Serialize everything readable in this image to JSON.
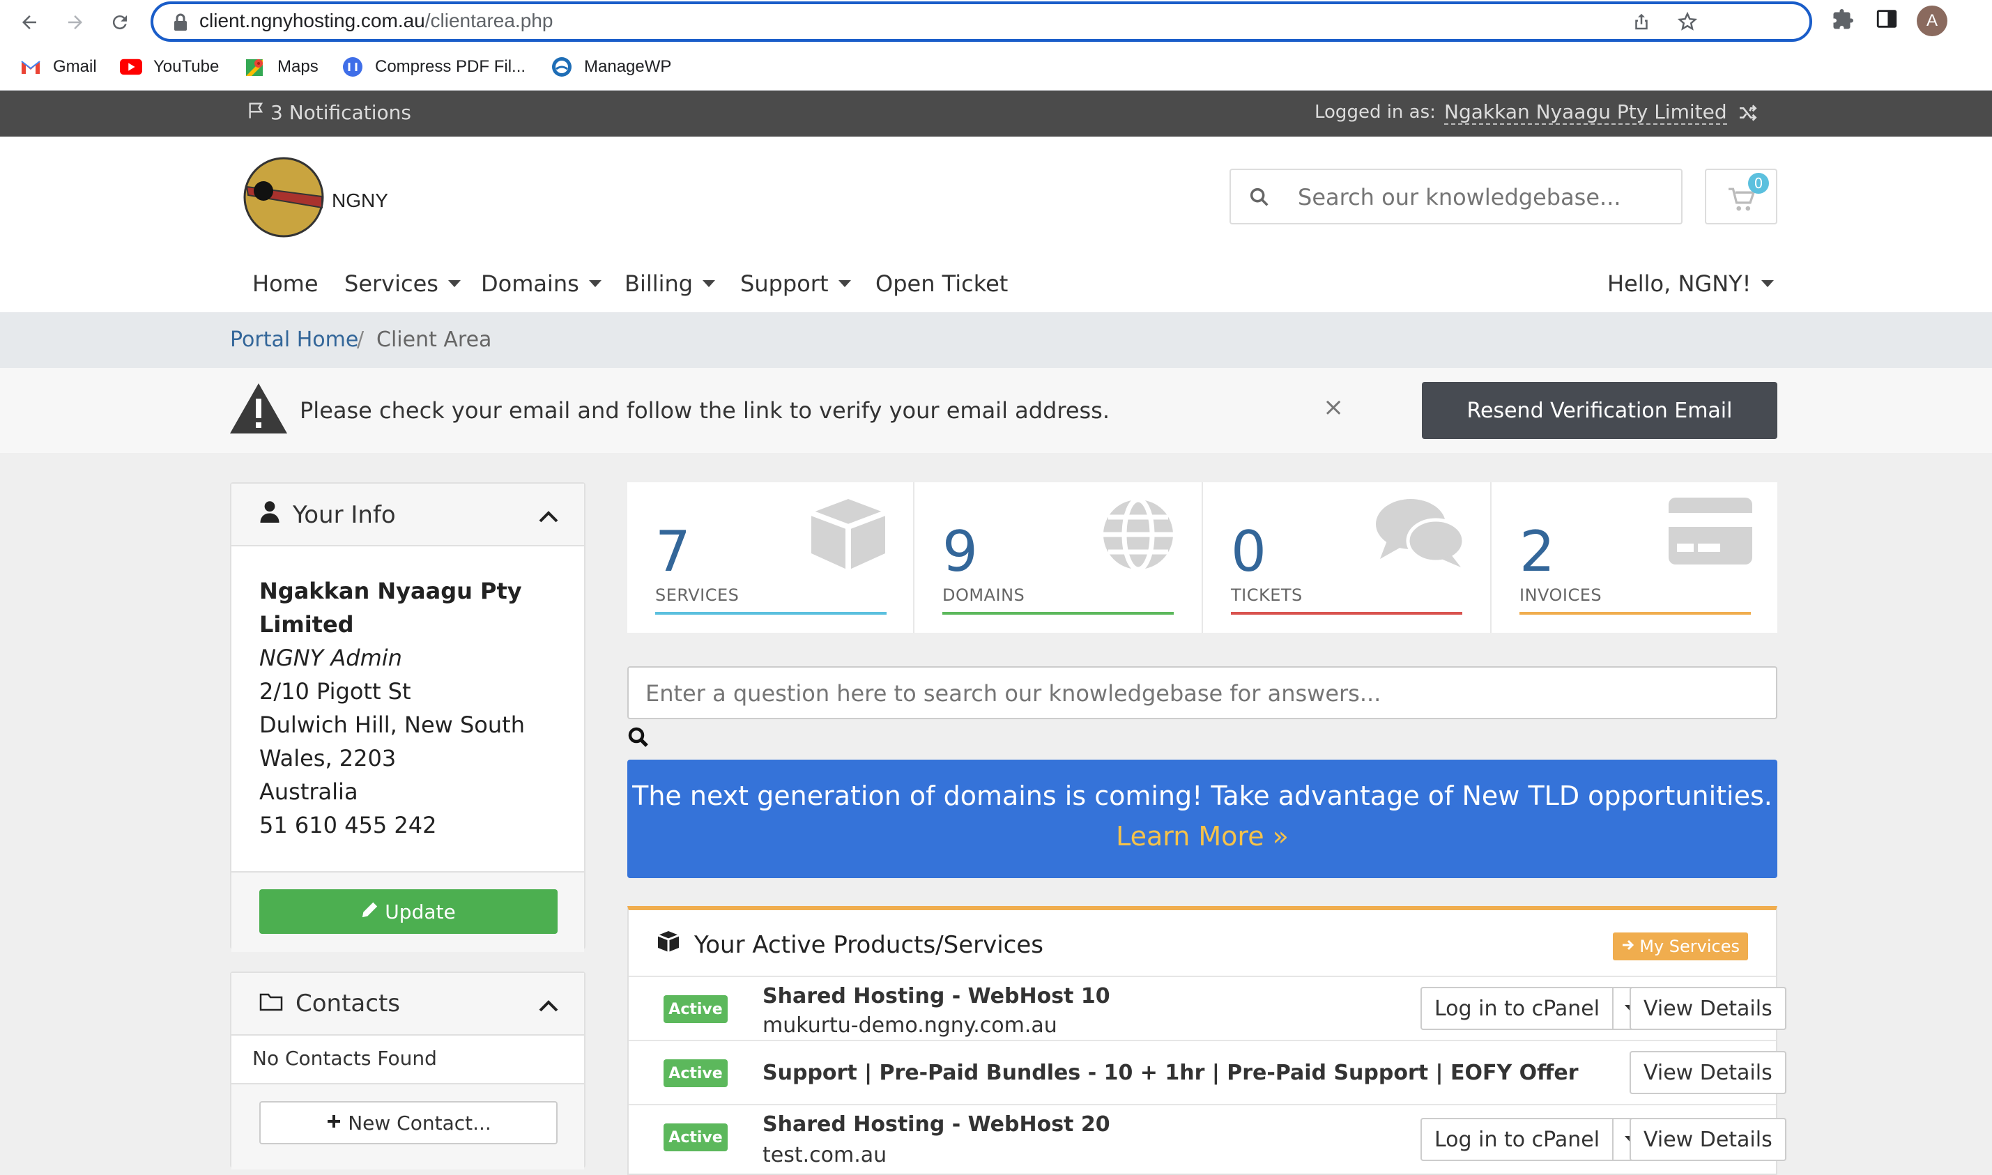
{
  "browser": {
    "url_host": "client.ngnyhosting.com.au",
    "url_path": "/clientarea.php",
    "profile_initial": "A",
    "bookmarks": [
      {
        "label": "Gmail",
        "icon": "gmail-icon"
      },
      {
        "label": "YouTube",
        "icon": "youtube-icon"
      },
      {
        "label": "Maps",
        "icon": "maps-icon"
      },
      {
        "label": "Compress PDF Fil...",
        "icon": "pdf-icon"
      },
      {
        "label": "ManageWP",
        "icon": "managewp-icon"
      }
    ]
  },
  "topbar": {
    "notifications": "3 Notifications",
    "logged_in_label": "Logged in as:",
    "logged_in_name": "Ngakkan Nyaagu Pty Limited"
  },
  "header": {
    "logo_text": "NGNY",
    "search_placeholder": "Search our knowledgebase...",
    "cart_count": "0"
  },
  "nav": {
    "items": [
      {
        "label": "Home",
        "dropdown": false
      },
      {
        "label": "Services",
        "dropdown": true
      },
      {
        "label": "Domains",
        "dropdown": true
      },
      {
        "label": "Billing",
        "dropdown": true
      },
      {
        "label": "Support",
        "dropdown": true
      },
      {
        "label": "Open Ticket",
        "dropdown": false
      }
    ],
    "user_menu": "Hello, NGNY!"
  },
  "breadcrumb": {
    "home": "Portal Home",
    "separator": "/",
    "current": "Client Area"
  },
  "alert": {
    "message": "Please check your email and follow the link to verify your email address.",
    "close": "×",
    "button": "Resend Verification Email"
  },
  "your_info": {
    "title": "Your Info",
    "company_line1": "Ngakkan Nyaagu Pty",
    "company_line2": "Limited",
    "role": "NGNY Admin",
    "address1": "2/10 Pigott St",
    "address2": "Dulwich Hill, New South",
    "address3": "Wales, 2203",
    "country": "Australia",
    "phone": "51 610 455 242",
    "update_button": "Update"
  },
  "contacts": {
    "title": "Contacts",
    "empty": "No Contacts Found",
    "new_button": "New Contact..."
  },
  "stats": [
    {
      "value": "7",
      "label": "SERVICES",
      "color": "#5bc0de",
      "icon": "cube-icon"
    },
    {
      "value": "9",
      "label": "DOMAINS",
      "color": "#5cb85c",
      "icon": "globe-icon"
    },
    {
      "value": "0",
      "label": "TICKETS",
      "color": "#d9534f",
      "icon": "comments-icon"
    },
    {
      "value": "2",
      "label": "INVOICES",
      "color": "#f0ad4e",
      "icon": "credit-card-icon"
    }
  ],
  "kb_question": {
    "placeholder": "Enter a question here to search our knowledgebase for answers..."
  },
  "promo": {
    "text": "The next generation of domains is coming! Take advantage of New TLD opportunities.",
    "link": "Learn More »",
    "bg_color": "#3573d9"
  },
  "products": {
    "title": "Your Active Products/Services",
    "my_services": "My Services",
    "rows": [
      {
        "status": "Active",
        "name": "Shared Hosting - WebHost 10",
        "domain": "mukurtu-demo.ngny.com.au",
        "login": "Log in to cPanel",
        "view": "View Details"
      },
      {
        "status": "Active",
        "name": "Support | Pre-Paid Bundles - 10 + 1hr | Pre-Paid Support | EOFY Offer",
        "domain": "",
        "login": "",
        "view": "View Details"
      },
      {
        "status": "Active",
        "name": "Shared Hosting - WebHost 20",
        "domain": "test.com.au",
        "login": "Log in to cPanel",
        "view": "View Details"
      }
    ]
  }
}
